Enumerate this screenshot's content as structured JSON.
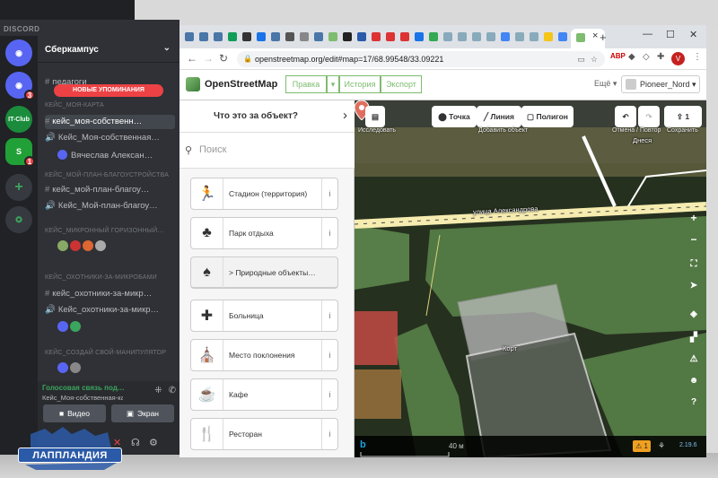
{
  "discord": {
    "brand": "DISCORD",
    "server_name": "Сберкампус",
    "server_menu_icon": "chevron-down",
    "mentions_pill": "НОВЫЕ УПОМИНАНИЯ",
    "guild_badges": [
      "3",
      "1"
    ],
    "guild_labels": [
      "IT-Club"
    ],
    "rows": [
      {
        "type": "channel",
        "text": "педагоги"
      },
      {
        "type": "category",
        "text": "КЕЙС_МОЯ-КАРТА"
      },
      {
        "type": "channel",
        "text": "кейс_моя-собственн…",
        "active": true
      },
      {
        "type": "voice",
        "text": "Кейс_Моя-собственная…"
      },
      {
        "type": "user",
        "text": "Вячеслав Алексан…"
      },
      {
        "type": "category",
        "text": "КЕЙС_МОЙ-ПЛАН-БЛАГОУСТРОЙСТВА"
      },
      {
        "type": "channel",
        "text": "кейс_мой-план-благоу…"
      },
      {
        "type": "voice",
        "text": "Кейс_Мой-план-благоу…"
      },
      {
        "type": "category",
        "text": "КЕЙС_МИКРОННЫЙ ГОРИЗОННЫЙ…"
      },
      {
        "type": "category",
        "text": "КЕЙС_ОХОТНИКИ-ЗА-МИКРОБАМИ"
      },
      {
        "type": "channel",
        "text": "кейс_охотники-за-микр…"
      },
      {
        "type": "voice",
        "text": "Кейс_охотники-за-микр…"
      },
      {
        "type": "category",
        "text": "КЕЙС_СОЗДАЙ СВОЙ-МАНИПУЛЯТОР"
      }
    ],
    "voice_panel": {
      "status": "Голосовая связь под…",
      "channel": "Кейс_Моя-собственная-ка…",
      "video_label": "Видео",
      "screen_label": "Экран"
    },
    "logo_text": "ЛАППЛАНДИЯ"
  },
  "browser": {
    "url": "openstreetmap.org/edit#map=17/68.99548/33.09221",
    "profile_initial": "V",
    "tab_close": "×",
    "new_tab": "+"
  },
  "osm": {
    "title": "OpenStreetMap",
    "edit_label": "Правка",
    "history_label": "История",
    "export_label": "Экспорт",
    "more_label": "Ещё",
    "username": "Pioneer_Nord"
  },
  "sidebar": {
    "title": "Что это за объект?",
    "search_placeholder": "Поиск",
    "presets": [
      {
        "label": "Стадион (территория)",
        "icon": "running-person-icon"
      },
      {
        "label": "Парк отдыха",
        "icon": "park-icon"
      },
      {
        "label": "> Природные объекты…",
        "icon": "nature-icon",
        "group": true
      },
      {
        "label": "Больница",
        "icon": "plus-icon"
      },
      {
        "label": "Место поклонения",
        "icon": "place-of-worship-icon"
      },
      {
        "label": "Кафе",
        "icon": "cup-icon"
      },
      {
        "label": "Ресторан",
        "icon": "fork-knife-icon"
      }
    ]
  },
  "map": {
    "inspect_caption": "Исследовать",
    "point_label": "Точка",
    "line_label": "Линия",
    "polygon_label": "Полигон",
    "add_caption": "Добавить объект",
    "undo_caption": "Отмена / Повтор",
    "save_count": "1",
    "save_caption": "Сохранить",
    "street_label": "улица Александрова",
    "place_label": "Корт",
    "poi_label": "Днеся",
    "scale_label": "40 м",
    "warning_count": "1",
    "version": "2.19.6"
  },
  "colors": {
    "discord_bg": "#2f3136",
    "discord_red": "#ed4245",
    "osm_green": "#7ebc6f",
    "park_green": "#7fbf6a",
    "road": "#f6ecb0"
  }
}
